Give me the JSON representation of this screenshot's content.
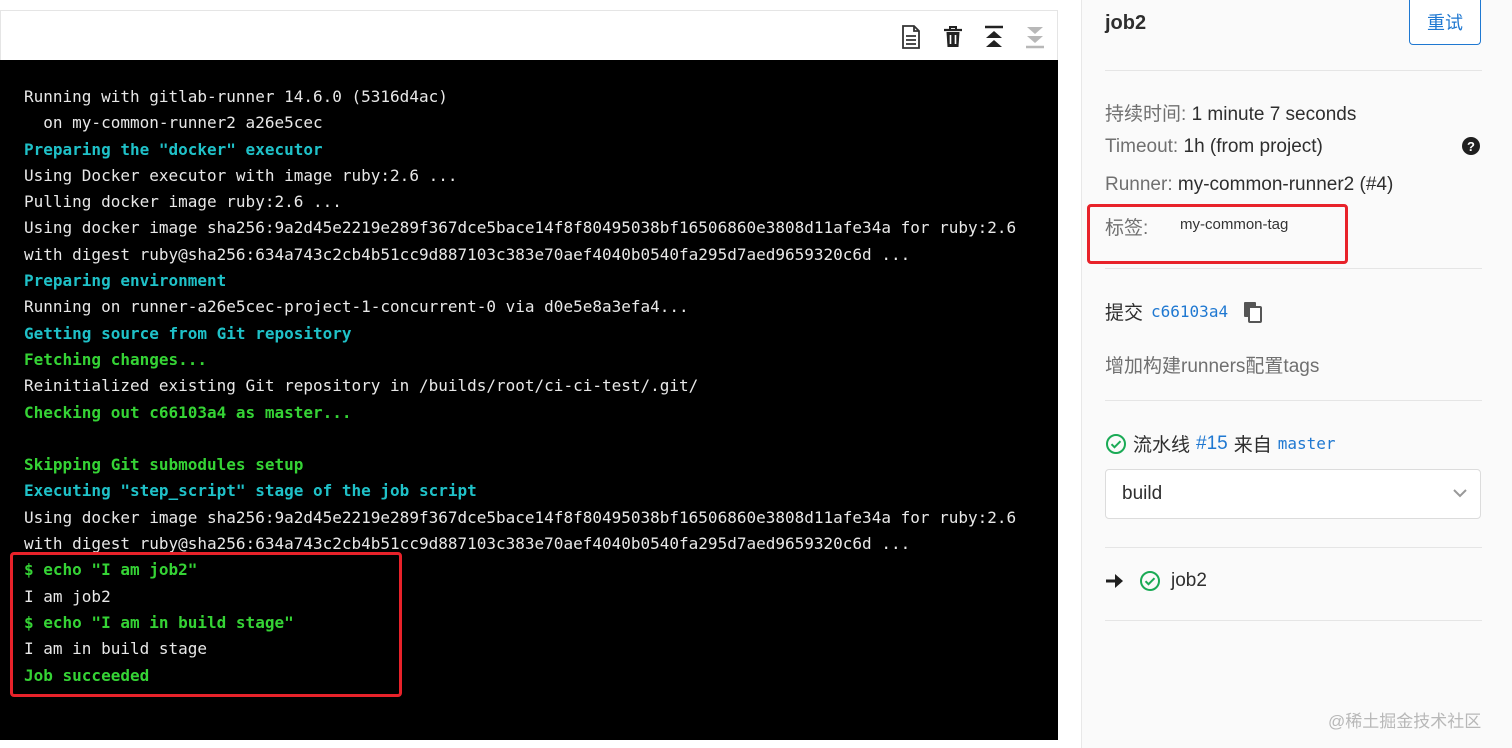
{
  "toolbar": {
    "icons": [
      "raw-log-icon",
      "erase-icon",
      "scroll-top-icon",
      "scroll-bottom-icon"
    ]
  },
  "log": {
    "lines": [
      {
        "text": "Running with gitlab-runner 14.6.0 (5316d4ac)",
        "style": "normal"
      },
      {
        "text": "  on my-common-runner2 a26e5cec",
        "style": "normal"
      },
      {
        "text": "Preparing the \"docker\" executor",
        "style": "cyan"
      },
      {
        "text": "Using Docker executor with image ruby:2.6 ...",
        "style": "normal"
      },
      {
        "text": "Pulling docker image ruby:2.6 ...",
        "style": "normal"
      },
      {
        "text": "Using docker image sha256:9a2d45e2219e289f367dce5bace14f8f80495038bf16506860e3808d11afe34a for ruby:2.6",
        "style": "normal"
      },
      {
        "text": "with digest ruby@sha256:634a743c2cb4b51cc9d887103c383e70aef4040b0540fa295d7aed9659320c6d ...",
        "style": "normal"
      },
      {
        "text": "Preparing environment",
        "style": "cyan"
      },
      {
        "text": "Running on runner-a26e5cec-project-1-concurrent-0 via d0e5e8a3efa4...",
        "style": "normal"
      },
      {
        "text": "Getting source from Git repository",
        "style": "cyan"
      },
      {
        "text": "Fetching changes...",
        "style": "green"
      },
      {
        "text": "Reinitialized existing Git repository in /builds/root/ci-ci-test/.git/",
        "style": "normal"
      },
      {
        "text": "Checking out c66103a4 as master...",
        "style": "green"
      },
      {
        "text": "",
        "style": "normal"
      },
      {
        "text": "Skipping Git submodules setup",
        "style": "green"
      },
      {
        "text": "Executing \"step_script\" stage of the job script",
        "style": "cyan"
      },
      {
        "text": "Using docker image sha256:9a2d45e2219e289f367dce5bace14f8f80495038bf16506860e3808d11afe34a for ruby:2.6",
        "style": "normal"
      },
      {
        "text": "with digest ruby@sha256:634a743c2cb4b51cc9d887103c383e70aef4040b0540fa295d7aed9659320c6d ...",
        "style": "normal"
      },
      {
        "text": "$ echo \"I am job2\"",
        "style": "green"
      },
      {
        "text": "I am job2",
        "style": "normal"
      },
      {
        "text": "$ echo \"I am in build stage\"",
        "style": "green"
      },
      {
        "text": "I am in build stage",
        "style": "normal"
      },
      {
        "text": "Job succeeded",
        "style": "green"
      }
    ]
  },
  "sidebar": {
    "title": "job2",
    "retry_label": "重试",
    "duration_label": "持续时间:",
    "duration_value": "1 minute 7 seconds",
    "timeout_label": "Timeout:",
    "timeout_value": "1h (from project)",
    "runner_label": "Runner:",
    "runner_value": "my-common-runner2 (#4)",
    "tags_label": "标签:",
    "tag": "my-common-tag",
    "commit_label": "提交",
    "commit_sha": "c66103a4",
    "commit_message": "增加构建runners配置tags",
    "pipeline_label": "流水线",
    "pipeline_id": "#15",
    "pipeline_from": "来自",
    "pipeline_ref": "master",
    "stage_selected": "build",
    "job_name": "job2"
  },
  "watermark": "@稀土掘金技术社区",
  "colors": {
    "link": "#1f78d1",
    "success": "#1aaa55",
    "log_cyan": "#1fc1c8",
    "log_green": "#35d335",
    "annotation_red": "#e8222a"
  }
}
